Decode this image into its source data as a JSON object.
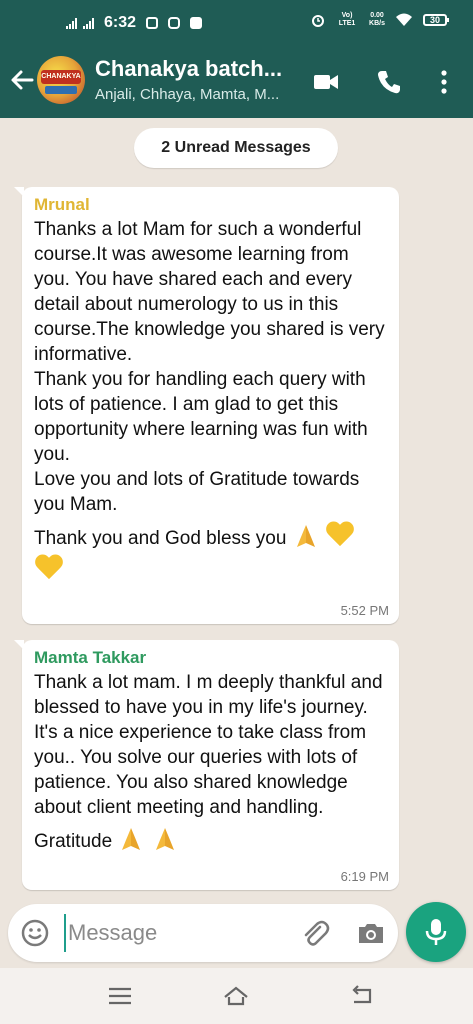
{
  "status_bar": {
    "time": "6:32",
    "network_label": "Vo) LTE1",
    "speed_value": "0.00",
    "speed_unit": "KB/s",
    "battery": "30",
    "icons": [
      "signal-icon",
      "signal-icon",
      "youtube-icon",
      "instagram-icon",
      "facebook-icon",
      "alarm-icon",
      "wifi-icon",
      "battery-icon"
    ]
  },
  "header": {
    "title": "Chanakya batch...",
    "subtitle": "Anjali, Chhaya, Mamta, M...",
    "avatar_text": "CHANAKYA",
    "icons": [
      "back-arrow-icon",
      "video-call-icon",
      "phone-icon",
      "more-options-icon"
    ]
  },
  "chat": {
    "unread_banner": "2 Unread Messages",
    "messages": [
      {
        "sender": "Mrunal",
        "sender_color": "#e0b634",
        "text": "Thanks a lot Mam for such a wonderful course.It was awesome learning from you. You have shared each and every detail about numerology to us in this course.The knowledge you shared is very informative.\nThank you for handling each query with lots of patience. I am glad to get this opportunity where learning was fun with you.\nLove you and lots of Gratitude towards you Mam.",
        "closing": "Thank you and God bless you",
        "emojis": [
          "folded-hands-icon",
          "yellow-heart-icon",
          "yellow-heart-icon"
        ],
        "time": "5:52 PM"
      },
      {
        "sender": "Mamta Takkar",
        "sender_color": "#2f9a5f",
        "text": "Thank a lot mam. I m deeply thankful and blessed to have you in my life's journey. It's a nice experience to take class from you.. You solve our queries with lots of patience. You also shared knowledge about client meeting and handling.",
        "closing": "Gratitude",
        "emojis": [
          "folded-hands-icon",
          "folded-hands-icon"
        ],
        "time": "6:19 PM"
      }
    ]
  },
  "input": {
    "placeholder": "Message",
    "icons": [
      "emoji-icon",
      "attach-icon",
      "camera-icon",
      "mic-icon"
    ]
  },
  "colors": {
    "header_bg": "#1f5c55",
    "chat_bg": "#ece5dd",
    "mic_bg": "#1aa37f"
  },
  "nav_bar": {
    "icons": [
      "menu-icon",
      "home-icon",
      "back-icon"
    ]
  }
}
